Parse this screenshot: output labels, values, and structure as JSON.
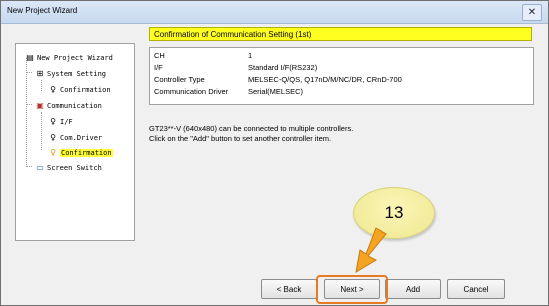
{
  "window": {
    "title": "New Project Wizard",
    "close_glyph": "✕"
  },
  "tree": {
    "items": [
      {
        "label": "New Project Wizard",
        "icon": "wizard-icon"
      },
      {
        "label": "System Setting",
        "icon": "system-icon"
      },
      {
        "label": "Confirmation",
        "icon": "bulb-icon"
      },
      {
        "label": "Communication",
        "icon": "communication-icon"
      },
      {
        "label": "I/F",
        "icon": "bulb-icon"
      },
      {
        "label": "Com.Driver",
        "icon": "bulb-icon"
      },
      {
        "label": "Confirmation",
        "icon": "bulb-lit-icon",
        "selected": true
      },
      {
        "label": "Screen Switch",
        "icon": "screen-icon"
      }
    ]
  },
  "header": {
    "title": "Confirmation of Communication Setting (1st)",
    "color": "#ffff20"
  },
  "settings": [
    {
      "key": "CH",
      "value": "1"
    },
    {
      "key": "I/F",
      "value": "Standard I/F(RS232)"
    },
    {
      "key": "Controller Type",
      "value": "MELSEC-Q/QS, Q17nD/M/NC/DR, CRnD-700"
    },
    {
      "key": "Communication Driver",
      "value": "Serial(MELSEC)"
    }
  ],
  "info": {
    "line1": "GT23**-V (640x480) can be connected to multiple controllers.",
    "line2": "Click on the \"Add\" button to set another controller item."
  },
  "buttons": {
    "back": "< Back",
    "next": "Next >",
    "add": "Add",
    "cancel": "Cancel"
  },
  "annotation": {
    "step_number": "13",
    "highlight_color": "#e87a22"
  }
}
